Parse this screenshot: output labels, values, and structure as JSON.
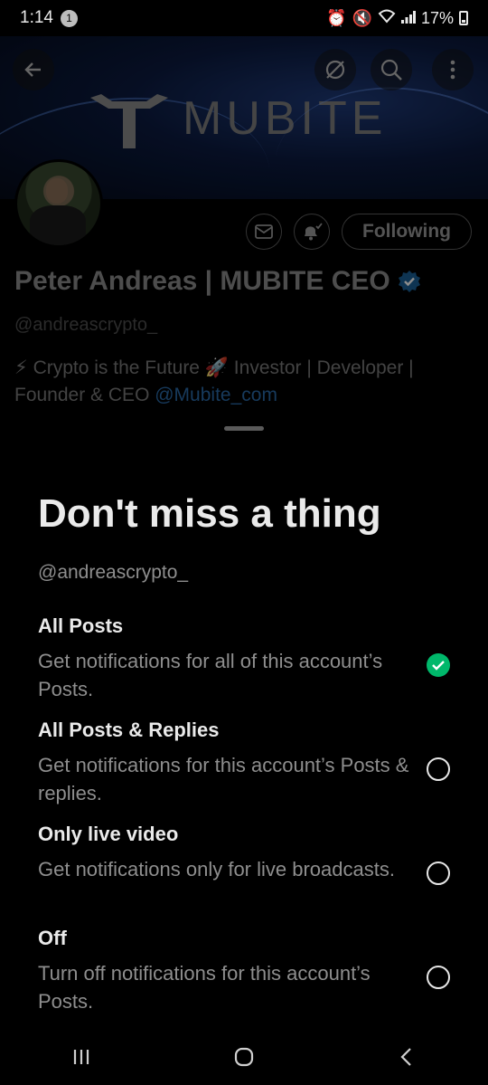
{
  "status_bar": {
    "time": "1:14",
    "notification_count": "1",
    "battery": "17%"
  },
  "banner": {
    "brand_text": "MUBITE"
  },
  "header_icons": [
    "back-arrow-icon",
    "crypto-icon",
    "search-icon",
    "more-icon"
  ],
  "profile": {
    "name": "Peter Andreas | MUBITE CEO",
    "handle": "@andreascrypto_",
    "bio_line1": "⚡ Crypto is the Future 🚀 Investor | Developer |",
    "bio_line2_prefix": "Founder & CEO ",
    "bio_mention": "@Mubite_com",
    "following_label": "Following",
    "colors": {
      "verified": "#1d9bf0",
      "mention": "#1d9bf0"
    }
  },
  "sheet": {
    "title": "Don't miss a thing",
    "handle": "@andreascrypto_",
    "options": [
      {
        "title": "All Posts",
        "description": "Get notifications for all of this account’s Posts.",
        "selected": true
      },
      {
        "title": "All Posts & Replies",
        "description": "Get notifications for this account’s Posts & replies.",
        "selected": false
      },
      {
        "title": "Only live video",
        "description": "Get notifications only for live broadcasts.",
        "selected": false
      },
      {
        "title": "Off",
        "description": "Turn off notifications for this account’s Posts.",
        "selected": false
      }
    ],
    "colors": {
      "selected": "#00b86b"
    }
  },
  "nav_bar": [
    "recent-apps-icon",
    "home-icon",
    "back-icon"
  ]
}
